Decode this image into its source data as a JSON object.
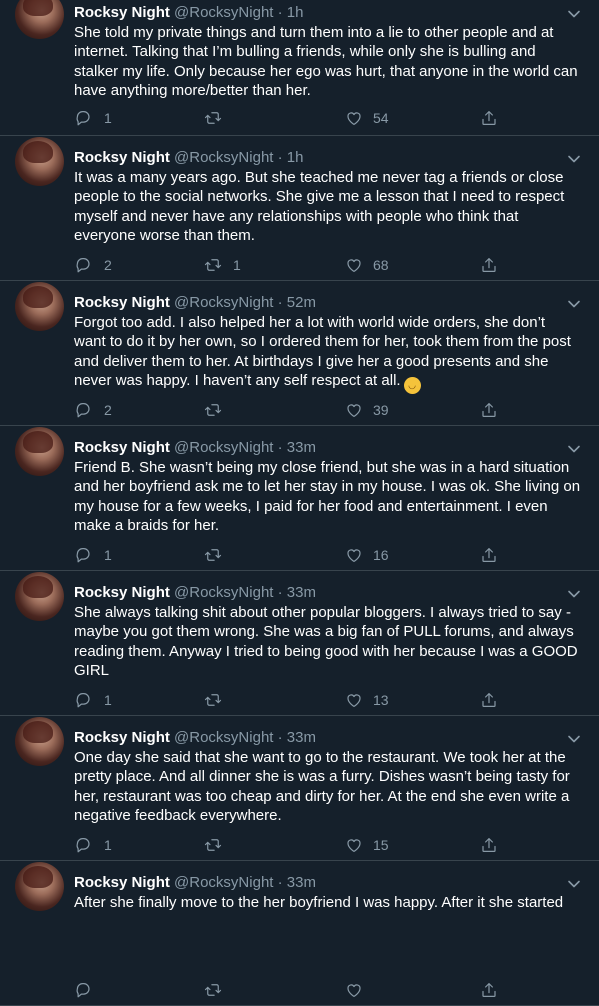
{
  "tweets": [
    {
      "name": "Rocksy Night",
      "handle": "@RocksyNight",
      "separator": "·",
      "time": "1h",
      "lines": [
        "She told my private things and turn them into a lie to other people and at",
        "internet. Talking that I’m bulling a friends, while only she is bulling and",
        "stalker my life. Only because her ego was hurt, that anyone in the world can",
        "have anything more/better than her."
      ],
      "replies": "1",
      "retweets": "",
      "likes": "54"
    },
    {
      "name": "Rocksy Night",
      "handle": "@RocksyNight",
      "separator": "·",
      "time": "1h",
      "lines": [
        "It was a many years ago. But she teached me never tag a friends or close",
        "people to the social networks. She give me a lesson that I need to respect",
        "myself and never have any relationships with people who think that",
        "everyone worse than them."
      ],
      "replies": "2",
      "retweets": "1",
      "likes": "68"
    },
    {
      "name": "Rocksy Night",
      "handle": "@RocksyNight",
      "separator": "·",
      "time": "52m",
      "lines": [
        "Forgot too add. I also helped her a lot with world wide orders, she don’t",
        "want to do it by her own, so I ordered them for her, took them from the post",
        "and deliver them to her. At birthdays I give her a good presents and she",
        "never was happy. I haven’t  any self respect at all."
      ],
      "emoji": "joy-emoji",
      "replies": "2",
      "retweets": "",
      "likes": "39"
    },
    {
      "name": "Rocksy Night",
      "handle": "@RocksyNight",
      "separator": "·",
      "time": "33m",
      "lines": [
        "Friend B. She wasn’t being my close friend, but she was in a hard situation",
        "and her boyfriend ask me to let her stay in my house. I was ok. She living on",
        "my house for a few weeks, I paid for her food and entertainment. I even",
        "make a braids for her."
      ],
      "replies": "1",
      "retweets": "",
      "likes": "16"
    },
    {
      "name": "Rocksy Night",
      "handle": "@RocksyNight",
      "separator": "·",
      "time": "33m",
      "lines": [
        "She always talking shit about other popular bloggers. I always tried to say -",
        "maybe you got them wrong. She was a big fan of PULL forums, and always",
        "reading them. Anyway I tried to being good with her because I was a GOOD",
        "GIRL"
      ],
      "replies": "1",
      "retweets": "",
      "likes": "13"
    },
    {
      "name": "Rocksy Night",
      "handle": "@RocksyNight",
      "separator": "·",
      "time": "33m",
      "lines": [
        "One day she said that she want to go to the restaurant. We took her at the",
        "pretty place. And all dinner she is was a furry. Dishes wasn’t being tasty for",
        "her, restaurant was too cheap and dirty for her. At the end she even write a",
        "negative feedback everywhere."
      ],
      "replies": "1",
      "retweets": "",
      "likes": "15"
    },
    {
      "name": "Rocksy Night",
      "handle": "@RocksyNight",
      "separator": "·",
      "time": "33m",
      "lines": [
        "After she finally move to the her boyfriend I was happy. After it she started"
      ],
      "replies": "",
      "retweets": "",
      "likes": ""
    }
  ],
  "icons": {
    "reply": "reply-icon",
    "retweet": "retweet-icon",
    "like": "heart-icon",
    "share": "share-icon",
    "menu": "chevron-down-icon"
  },
  "colors": {
    "background": "#15202b",
    "text": "#ffffff",
    "secondary_text": "#8899a6",
    "divider": "#38444d"
  }
}
